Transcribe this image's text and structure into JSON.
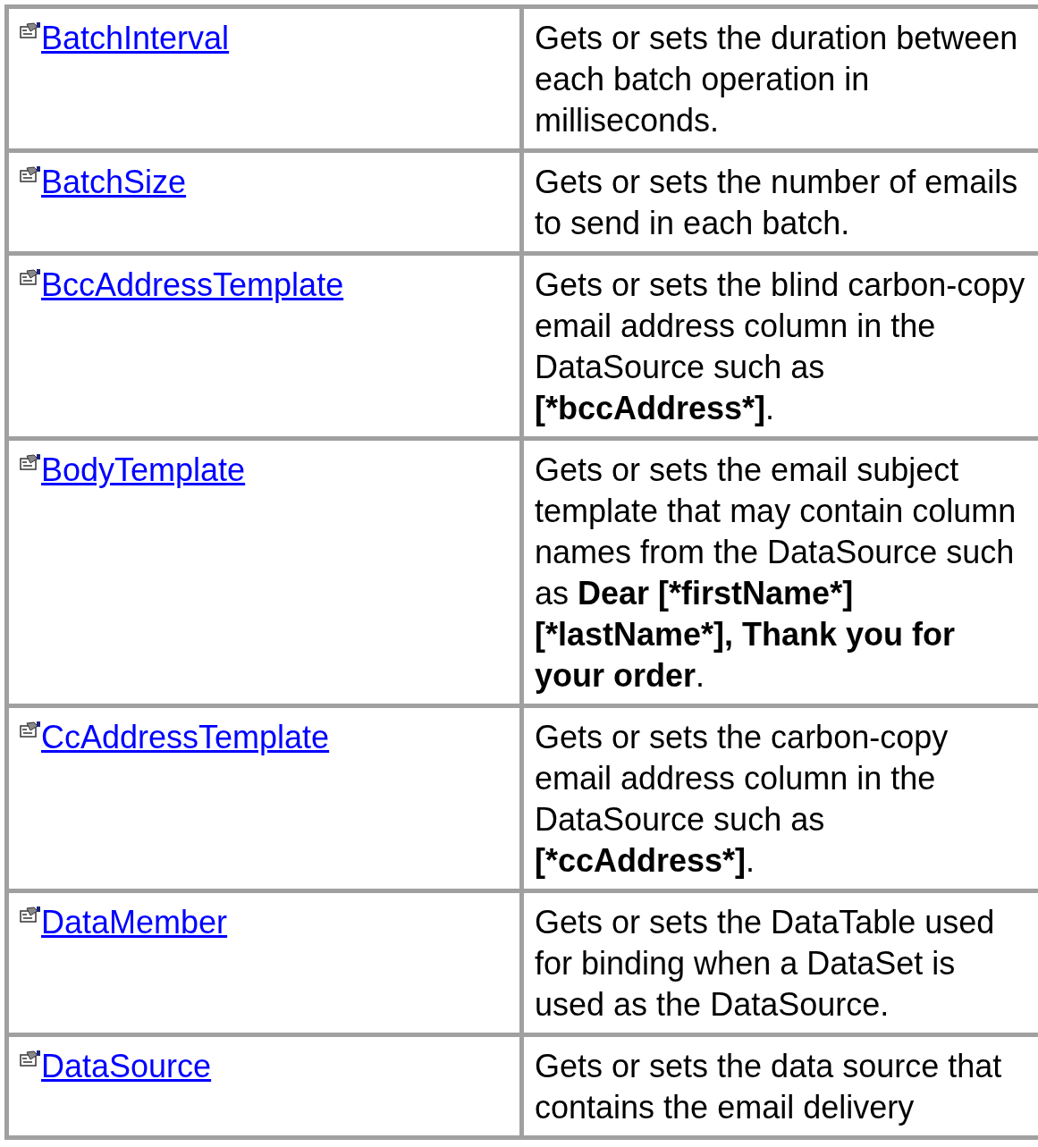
{
  "members": [
    {
      "name": "BatchInterval",
      "description": [
        {
          "text": "Gets or sets the duration between each batch operation in milliseconds.",
          "bold": false
        }
      ]
    },
    {
      "name": "BatchSize",
      "description": [
        {
          "text": "Gets or sets the number of emails to send in each batch.",
          "bold": false
        }
      ]
    },
    {
      "name": "BccAddressTemplate",
      "description": [
        {
          "text": "Gets or sets the blind carbon-copy email address column in the DataSource such as ",
          "bold": false
        },
        {
          "text": "[*bccAddress*]",
          "bold": true
        },
        {
          "text": ".",
          "bold": false
        }
      ]
    },
    {
      "name": "BodyTemplate",
      "description": [
        {
          "text": "Gets or sets the email subject template that may contain column names from the DataSource such as ",
          "bold": false
        },
        {
          "text": "Dear [*firstName*] [*lastName*], Thank you for your order",
          "bold": true
        },
        {
          "text": ".",
          "bold": false
        }
      ]
    },
    {
      "name": "CcAddressTemplate",
      "description": [
        {
          "text": "Gets or sets the carbon-copy email address column in the DataSource such as ",
          "bold": false
        },
        {
          "text": "[*ccAddress*]",
          "bold": true
        },
        {
          "text": ".",
          "bold": false
        }
      ]
    },
    {
      "name": "DataMember",
      "description": [
        {
          "text": "Gets or sets the DataTable used for binding when a DataSet is used as the DataSource.",
          "bold": false
        }
      ]
    },
    {
      "name": "DataSource",
      "description": [
        {
          "text": "Gets or sets the data source that contains the email delivery",
          "bold": false
        }
      ]
    }
  ]
}
